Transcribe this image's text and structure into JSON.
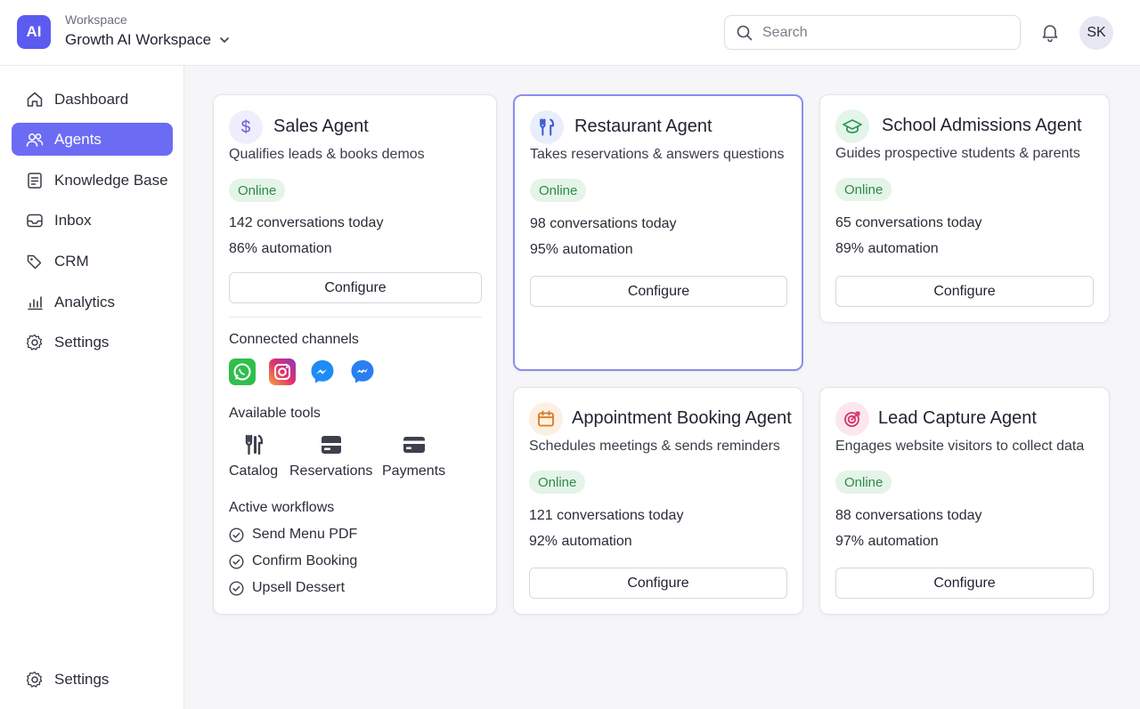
{
  "header": {
    "logo_text": "AI",
    "workspace_label": "Workspace",
    "workspace_name": "Growth AI Workspace",
    "search_placeholder": "Search",
    "avatar_initials": "SK"
  },
  "sidebar": {
    "items": [
      {
        "label": "Dashboard",
        "icon": "home-icon"
      },
      {
        "label": "Agents",
        "icon": "users-icon",
        "active": true
      },
      {
        "label": "Knowledge Base",
        "icon": "document-icon"
      },
      {
        "label": "Inbox",
        "icon": "inbox-icon"
      },
      {
        "label": "CRM",
        "icon": "tag-icon"
      },
      {
        "label": "Analytics",
        "icon": "bar-chart-icon"
      },
      {
        "label": "Settings",
        "icon": "gear-icon"
      }
    ],
    "footer_settings": "Settings"
  },
  "agents": [
    {
      "title": "Sales Agent",
      "description": "Qualifies leads & books demos",
      "status": "Online",
      "conversations": "142 conversations today",
      "automation": "86% automation",
      "configure": "Configure",
      "icon": "dollar-icon",
      "icon_color": "#6b5bd6",
      "icon_bg": "#efeefc",
      "connected_channels_label": "Connected channels",
      "channels": [
        "whatsapp-icon",
        "instagram-icon",
        "messenger-icon",
        "messenger-blue-icon"
      ],
      "available_tools_label": "Available tools",
      "tools": [
        {
          "label": "Catalog",
          "icon": "utensils-icon"
        },
        {
          "label": "Reservations",
          "icon": "reservations-icon"
        },
        {
          "label": "Payments",
          "icon": "credit-card-icon"
        }
      ],
      "active_workflows_label": "Active workflows",
      "workflows": [
        "Send Menu PDF",
        "Confirm Booking",
        "Upsell Dessert"
      ]
    },
    {
      "title": "Restaurant Agent",
      "description": "Takes reservations & answers questions",
      "status": "Online",
      "conversations": "98 conversations today",
      "automation": "95% automation",
      "configure": "Configure",
      "icon": "utensils-icon",
      "icon_color": "#3b5bcc",
      "icon_bg": "#e9eefc"
    },
    {
      "title": "School Admissions Agent",
      "description": "Guides prospective students & parents",
      "status": "Online",
      "conversations": "65 conversations today",
      "automation": "89% automation",
      "configure": "Configure",
      "icon": "graduation-cap-icon",
      "icon_color": "#2f9a5a",
      "icon_bg": "#e4f5ea"
    },
    {
      "title": "Appointment Booking Agent",
      "description": "Schedules meetings & sends reminders",
      "status": "Online",
      "conversations": "121 conversations today",
      "automation": "92% automation",
      "configure": "Configure",
      "icon": "calendar-icon",
      "icon_color": "#d97a1e",
      "icon_bg": "#fdf0e3"
    },
    {
      "title": "Lead Capture Agent",
      "description": "Engages website visitors to collect data",
      "status": "Online",
      "conversations": "88 conversations today",
      "automation": "97% automation",
      "configure": "Configure",
      "icon": "target-icon",
      "icon_color": "#d6336c",
      "icon_bg": "#fce7ee"
    }
  ],
  "colors": {
    "accent": "#6b6cf3",
    "logo": "#5b5bf0",
    "online_bg": "#e4f4e8",
    "online_text": "#2f8a48",
    "selected_border": "#8c8cf0"
  }
}
